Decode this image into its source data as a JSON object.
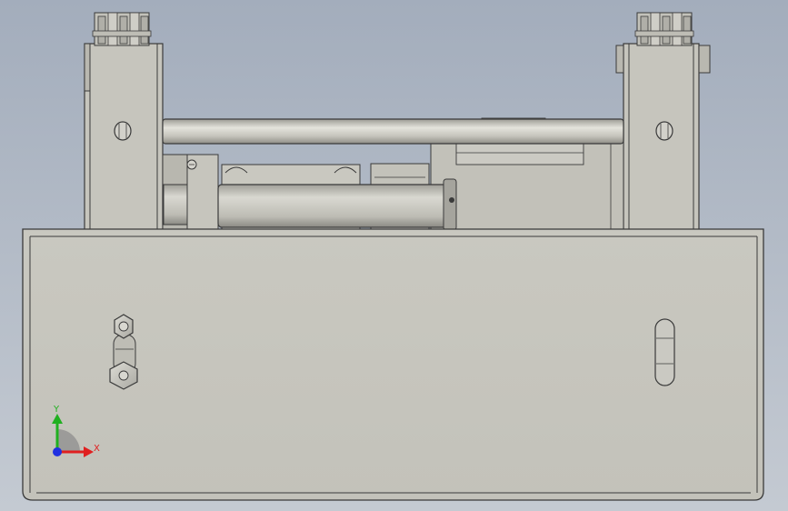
{
  "viewport": {
    "background_top": "#a3adbc",
    "background_bottom": "#c4cad2"
  },
  "model": {
    "part_fill": "#c8c7bf",
    "part_edge": "#3a3a3a",
    "shaft_light": "#e2e1da",
    "shaft_dark": "#8f8e88"
  },
  "triad": {
    "x_label": "X",
    "y_label": "Y",
    "x_color": "#e02020",
    "y_color": "#20b020",
    "z_color": "#2030e0"
  }
}
